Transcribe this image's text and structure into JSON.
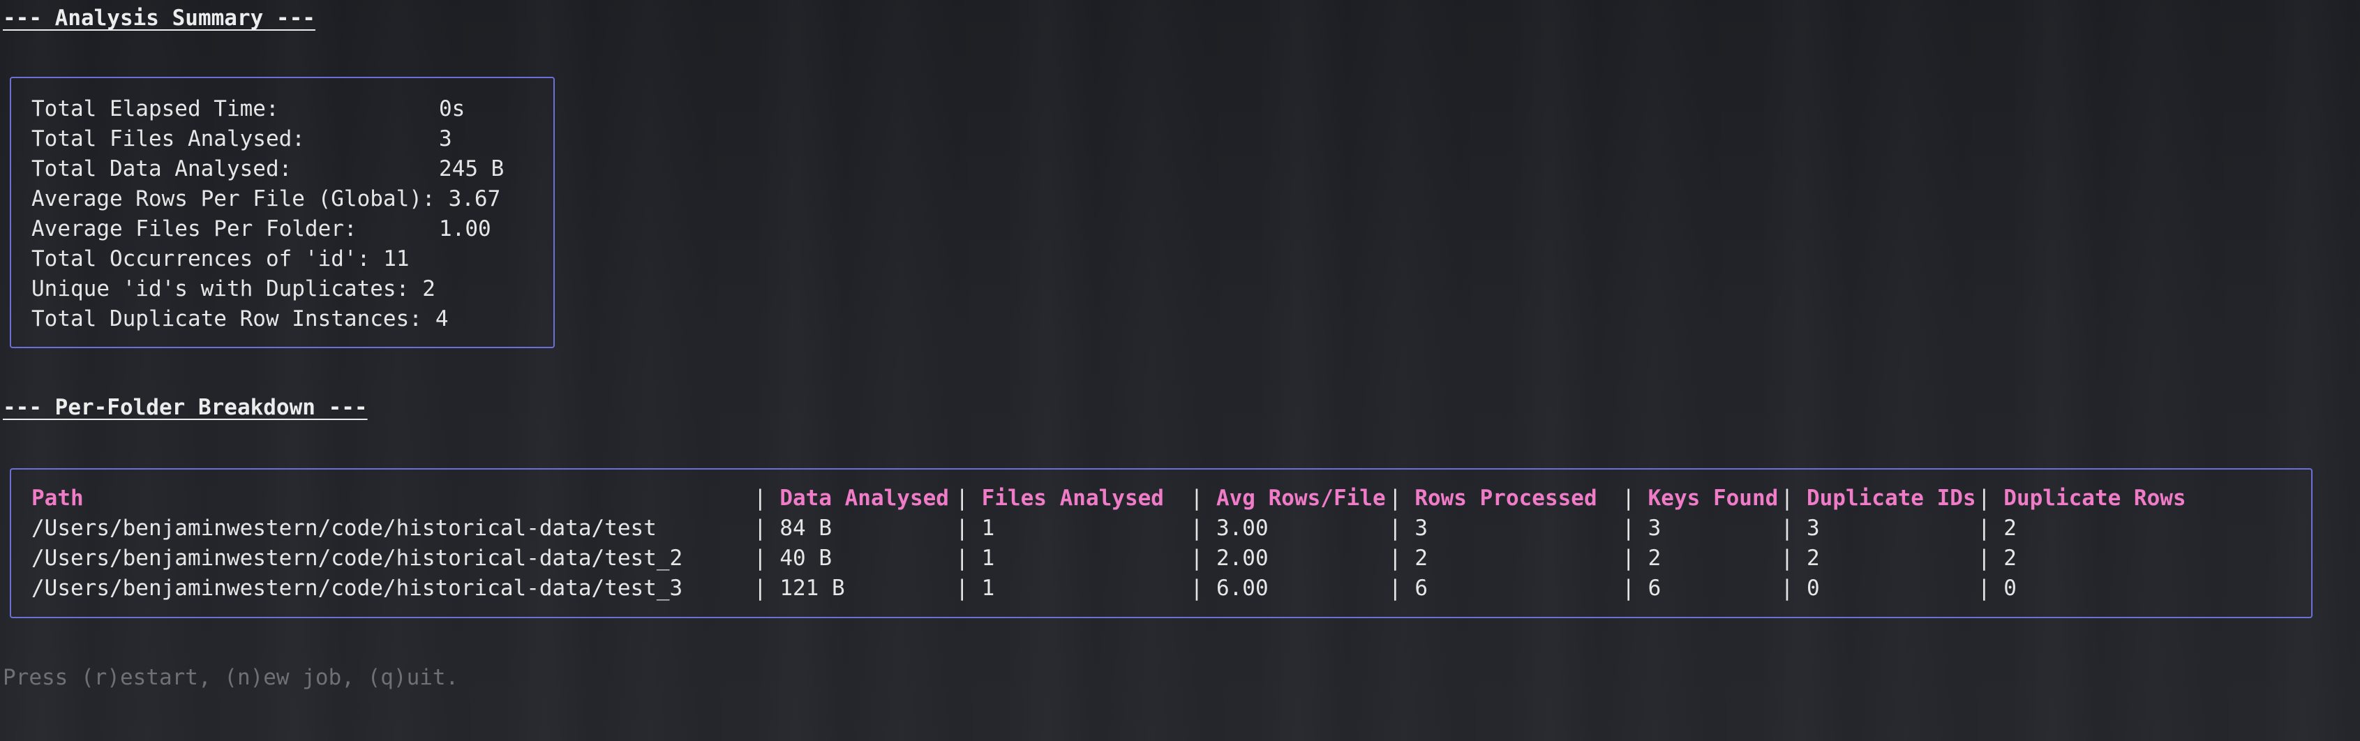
{
  "summary": {
    "heading": "--- Analysis Summary ---",
    "rows": [
      {
        "label": "Total Elapsed Time:",
        "value": "0s"
      },
      {
        "label": "Total Files Analysed:",
        "value": "3"
      },
      {
        "label": "Total Data Analysed:",
        "value": "245 B"
      },
      {
        "label": "Average Rows Per File (Global):",
        "value": "3.67"
      },
      {
        "label": "Average Files Per Folder:",
        "value": "1.00"
      },
      {
        "label": "Total Occurrences of 'id':",
        "value": "11"
      },
      {
        "label": "Unique 'id's with Duplicates:",
        "value": "2"
      },
      {
        "label": "Total Duplicate Row Instances:",
        "value": "4"
      }
    ]
  },
  "breakdown": {
    "heading": "--- Per-Folder Breakdown ---",
    "columns": [
      "Path",
      "Data Analysed",
      "Files Analysed",
      "Avg Rows/File",
      "Rows Processed",
      "Keys Found",
      "Duplicate IDs",
      "Duplicate Rows"
    ],
    "rows": [
      [
        "/Users/benjaminwestern/code/historical-data/test",
        "84 B",
        "1",
        "3.00",
        "3",
        "3",
        "3",
        "2"
      ],
      [
        "/Users/benjaminwestern/code/historical-data/test_2",
        "40 B",
        "1",
        "2.00",
        "2",
        "2",
        "2",
        "2"
      ],
      [
        "/Users/benjaminwestern/code/historical-data/test_3",
        "121 B",
        "1",
        "6.00",
        "6",
        "6",
        "0",
        "0"
      ]
    ]
  },
  "footer": {
    "hint": "Press (r)estart, (n)ew job, (q)uit."
  }
}
